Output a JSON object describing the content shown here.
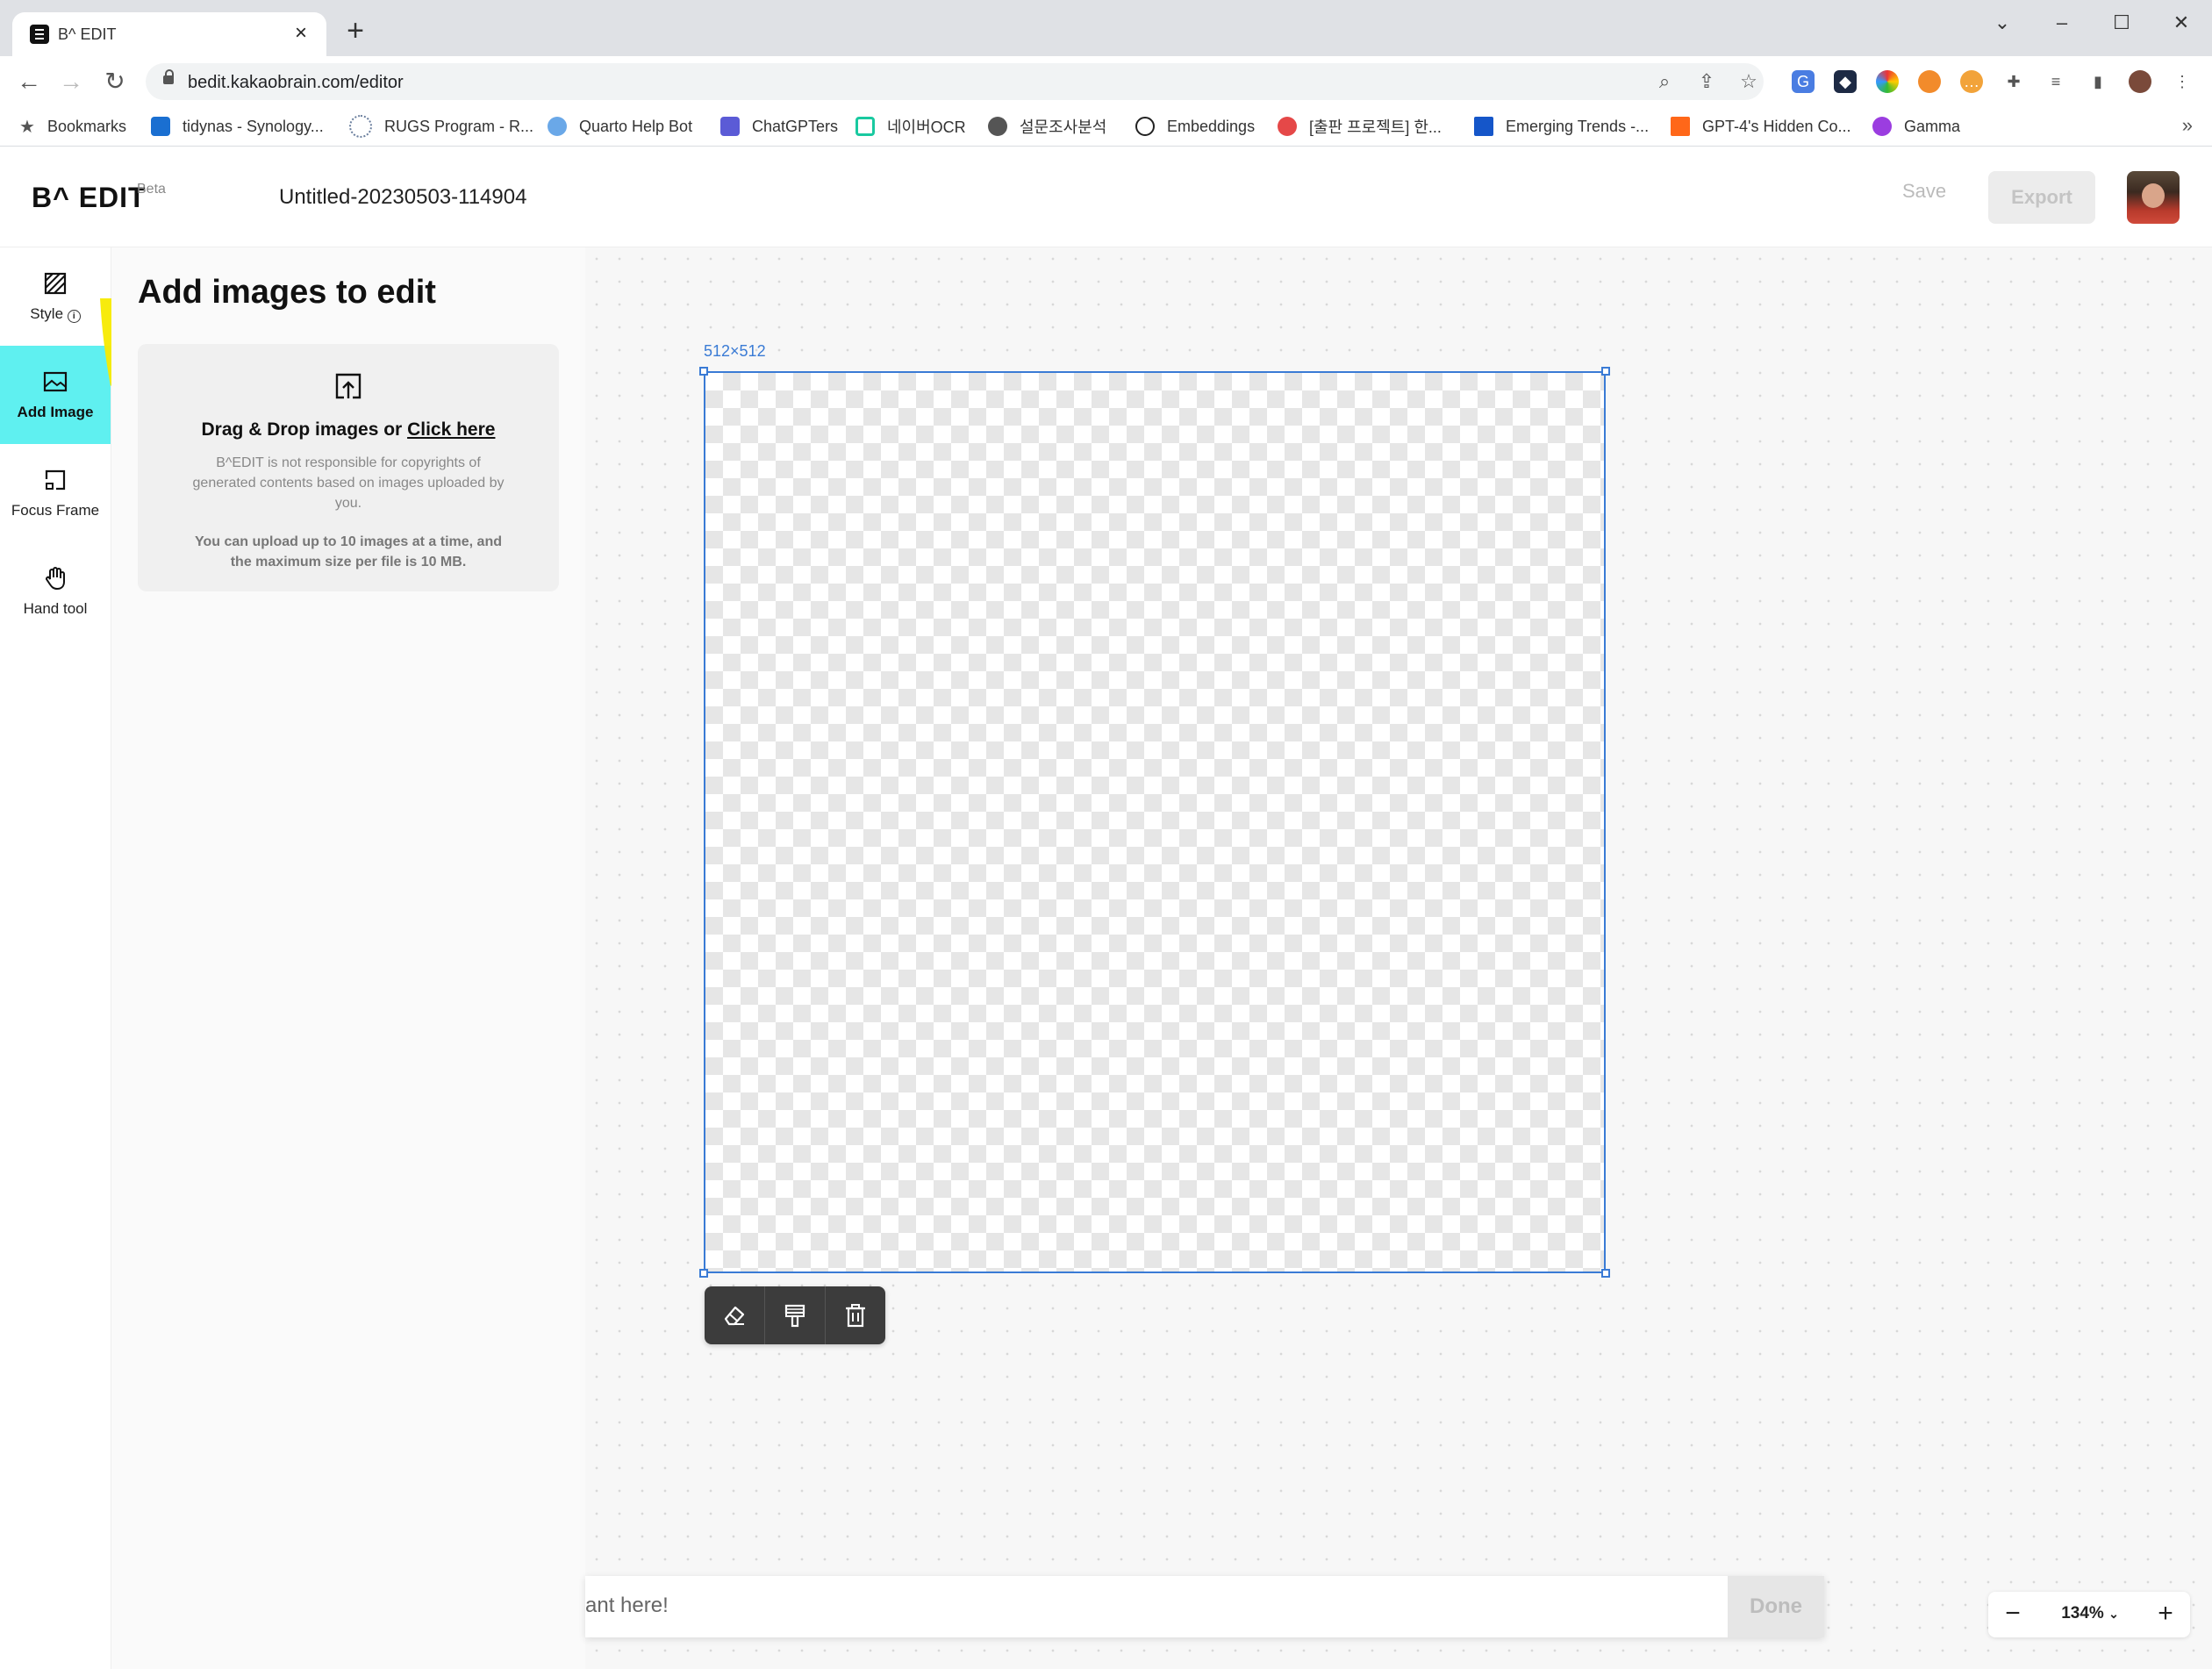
{
  "browser": {
    "tab_title": "B^ EDIT",
    "url": "bedit.kakaobrain.com/editor",
    "bookmarks_label": "Bookmarks",
    "bookmarks": [
      {
        "label": "tidynas - Synology...",
        "icon": "synology-dsm-icon",
        "color": "#1a6fd1"
      },
      {
        "label": "RUGS Program - R...",
        "icon": "rugs-r-icon",
        "color": "#6b7f9e"
      },
      {
        "label": "Quarto Help Bot",
        "icon": "globe-icon",
        "color": "#6aa8e8"
      },
      {
        "label": "ChatGPTers",
        "icon": "chatgpters-icon",
        "color": "#5b5bd6"
      },
      {
        "label": "네이버OCR",
        "icon": "clova-icon",
        "color": "#19c9a0"
      },
      {
        "label": "설문조사분석",
        "icon": "world-icon",
        "color": "#555555"
      },
      {
        "label": "Embeddings",
        "icon": "openai-icon",
        "color": "#222222"
      },
      {
        "label": "[출판 프로젝트] 한...",
        "icon": "red-circle-icon",
        "color": "#e54848"
      },
      {
        "label": "Emerging Trends -...",
        "icon": "blue-square-icon",
        "color": "#1556c9"
      },
      {
        "label": "GPT-4's Hidden Co...",
        "icon": "substack-icon",
        "color": "#ff6719"
      },
      {
        "label": "Gamma",
        "icon": "gamma-icon",
        "color": "#9b3de0"
      }
    ]
  },
  "app": {
    "logo": "B^ EDIT",
    "beta": "Beta",
    "doc_title": "Untitled-20230503-114904",
    "save_label": "Save",
    "export_label": "Export",
    "accent_color": "#5ff0f0",
    "frame_color": "#3a7bd5"
  },
  "rail": {
    "items": [
      {
        "label": "Style",
        "icon": "style-icon"
      },
      {
        "label": "Add Image",
        "icon": "image-icon",
        "active": true
      },
      {
        "label": "Focus Frame",
        "icon": "focus-frame-icon"
      },
      {
        "label": "Hand tool",
        "icon": "hand-icon"
      }
    ]
  },
  "panel": {
    "title": "Add images to edit",
    "drop_text": "Drag & Drop images or ",
    "click_here": "Click here",
    "note": "B^EDIT is not responsible for copyrights of generated contents based on images uploaded by you.",
    "limit": "You can upload up to 10 images at a time, and the maximum size per file is 10 MB."
  },
  "canvas": {
    "size_label": "512×512",
    "prompt_placeholder": "ant here!",
    "done_label": "Done",
    "zoom": "134%",
    "toolbar": [
      "eraser-icon",
      "paint-roller-icon",
      "trash-icon"
    ]
  }
}
